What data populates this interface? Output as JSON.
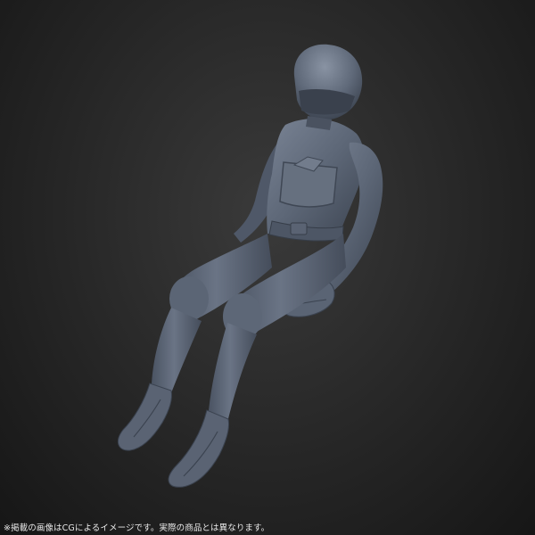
{
  "image": {
    "subject": "pilot-figure",
    "caption": "※掲載の画像はCGによるイメージです。実際の商品とは異なります。",
    "colors": {
      "background_center": "#3a3a3a",
      "background_edge": "#161616",
      "figure_base": "#5d6777",
      "figure_shadow": "#3d4552",
      "figure_highlight": "#8993a3",
      "caption_text": "#e8e8e8"
    }
  }
}
